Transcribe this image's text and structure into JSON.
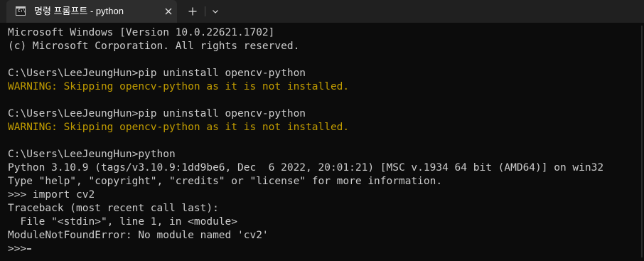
{
  "window": {
    "tab_title": "명령 프롬프트 - python",
    "tab_icon_text": "C:\\",
    "icons": {
      "tab": "command-prompt-icon",
      "close": "close-icon",
      "new_tab": "plus-icon",
      "dropdown": "chevron-down-icon"
    }
  },
  "console": {
    "colors": {
      "text": "#cccccc",
      "warning": "#c19c00",
      "background": "#0c0c0c"
    },
    "lines": [
      {
        "text": "Microsoft Windows [Version 10.0.22621.1702]",
        "kind": "normal"
      },
      {
        "text": "(c) Microsoft Corporation. All rights reserved.",
        "kind": "normal"
      },
      {
        "text": "",
        "kind": "blank"
      },
      {
        "text": "C:\\Users\\LeeJeungHun>pip uninstall opencv-python",
        "kind": "normal"
      },
      {
        "text": "WARNING: Skipping opencv-python as it is not installed.",
        "kind": "warn"
      },
      {
        "text": "",
        "kind": "blank"
      },
      {
        "text": "C:\\Users\\LeeJeungHun>pip uninstall opencv-python",
        "kind": "normal"
      },
      {
        "text": "WARNING: Skipping opencv-python as it is not installed.",
        "kind": "warn"
      },
      {
        "text": "",
        "kind": "blank"
      },
      {
        "text": "C:\\Users\\LeeJeungHun>python",
        "kind": "normal"
      },
      {
        "text": "Python 3.10.9 (tags/v3.10.9:1dd9be6, Dec  6 2022, 20:01:21) [MSC v.1934 64 bit (AMD64)] on win32",
        "kind": "normal"
      },
      {
        "text": "Type \"help\", \"copyright\", \"credits\" or \"license\" for more information.",
        "kind": "normal"
      },
      {
        "text": ">>> import cv2",
        "kind": "normal"
      },
      {
        "text": "Traceback (most recent call last):",
        "kind": "normal"
      },
      {
        "text": "  File \"<stdin>\", line 1, in <module>",
        "kind": "normal"
      },
      {
        "text": "ModuleNotFoundError: No module named 'cv2'",
        "kind": "normal"
      },
      {
        "text": ">>>",
        "kind": "prompt"
      }
    ]
  }
}
